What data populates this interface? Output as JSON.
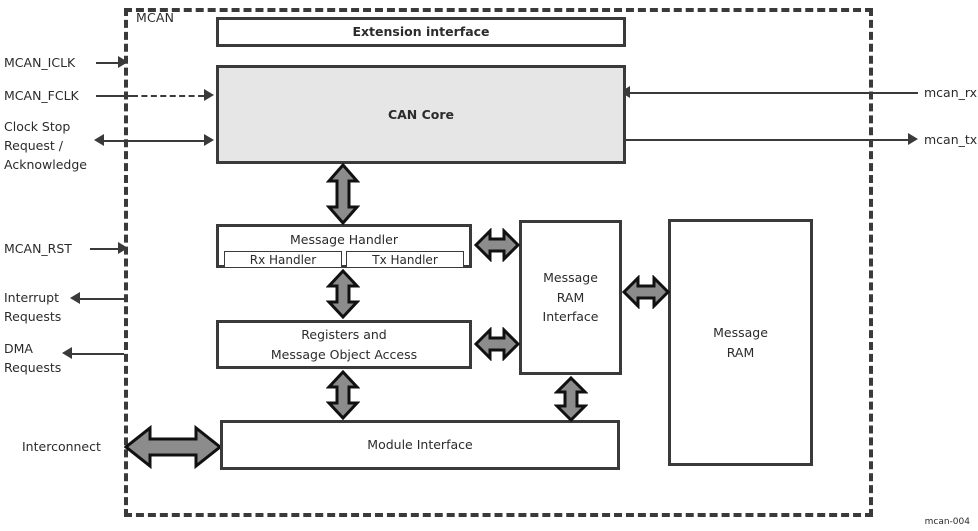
{
  "figure": {
    "id_caption": "mcan-004",
    "boundary_label": "MCAN"
  },
  "blocks": {
    "extension_interface": "Extension interface",
    "can_core": "CAN Core",
    "message_handler": "Message Handler",
    "rx_handler": "Rx Handler",
    "tx_handler": "Tx Handler",
    "registers_line1": "Registers and",
    "registers_line2": "Message Object Access",
    "message_ram_interface_line1": "Message",
    "message_ram_interface_line2": "RAM",
    "message_ram_interface_line3": "Interface",
    "message_ram_line1": "Message",
    "message_ram_line2": "RAM",
    "module_interface": "Module Interface"
  },
  "signals": {
    "left": [
      {
        "name": "mcan-iclk",
        "label": "MCAN_ICLK",
        "direction": "in",
        "style": "solid"
      },
      {
        "name": "mcan-fclk",
        "label": "MCAN_FCLK",
        "direction": "in",
        "style": "dashed"
      },
      {
        "name": "clock-stop",
        "label": "Clock Stop\nRequest /\nAcknowledge",
        "direction": "bidirectional",
        "style": "solid"
      },
      {
        "name": "mcan-rst",
        "label": "MCAN_RST",
        "direction": "in",
        "style": "solid"
      },
      {
        "name": "interrupt-requests",
        "label": "Interrupt\nRequests",
        "direction": "out",
        "style": "solid"
      },
      {
        "name": "dma-requests",
        "label": "DMA\nRequests",
        "direction": "out",
        "style": "solid"
      },
      {
        "name": "interconnect",
        "label": "Interconnect",
        "direction": "bidirectional",
        "style": "block-arrow"
      }
    ],
    "right": [
      {
        "name": "mcan-rx",
        "label": "mcan_rx",
        "direction": "in",
        "style": "solid"
      },
      {
        "name": "mcan-tx",
        "label": "mcan_tx",
        "direction": "out",
        "style": "solid"
      }
    ]
  },
  "colors": {
    "line": "#3a3a3a",
    "text": "#2b2b2b",
    "block_fill": "#ffffff",
    "shaded_fill": "#e6e6e6",
    "arrow_fill": "#8c8c8c",
    "arrow_stroke": "#111111",
    "background": "#ffffff"
  }
}
